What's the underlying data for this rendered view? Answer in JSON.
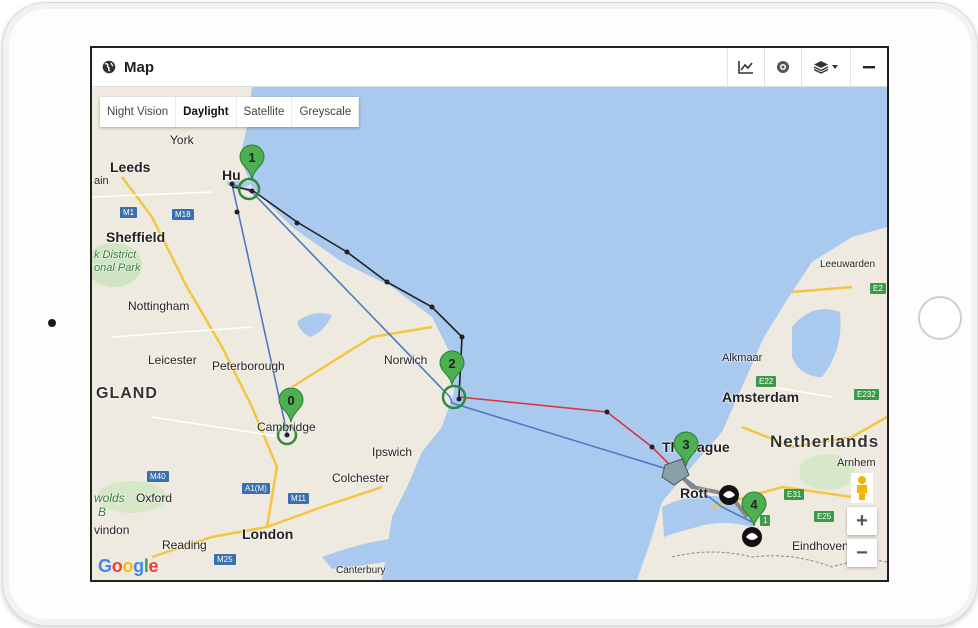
{
  "header": {
    "title": "Map",
    "tools": [
      "chart-icon",
      "target-icon",
      "layers-icon",
      "minimize-icon"
    ]
  },
  "map_types": {
    "items": [
      "Night Vision",
      "Daylight",
      "Satellite",
      "Greyscale"
    ],
    "active": "Daylight"
  },
  "zoom": {
    "in": "+",
    "out": "−"
  },
  "places": {
    "york": "York",
    "leeds": "Leeds",
    "sheffield": "Sheffield",
    "peak": "k District",
    "park": "onal Park",
    "nottingham": "Nottingham",
    "leicester": "Leicester",
    "peterborough": "Peterborough",
    "england": "GLAND",
    "norwich": "Norwich",
    "cambridge": "Cambridge",
    "ipswich": "Ipswich",
    "colchester": "Colchester",
    "oxford": "Oxford",
    "cotswolds": "wolds",
    "swindon": "vindon",
    "reading": "Reading",
    "london": "London",
    "canterbury": "Canterbury",
    "hull": "Hu",
    "alkmaar": "Alkmaar",
    "amsterdam": "Amsterdam",
    "the_hague": "Th  Hague",
    "netherlands": "Netherlands",
    "arnhem": "Arnhem",
    "rotterdam": "Rott",
    "eindhoven": "Eindhoven",
    "leeuwarden": "Leeuwarden",
    "ain": "ain",
    "b": "B"
  },
  "roads": {
    "m1": "M1",
    "m18": "M18",
    "m40": "M40",
    "a1m": "A1(M)",
    "m11": "M11",
    "m25": "M25",
    "e22": "E22",
    "e232": "E232",
    "e31": "E31",
    "e25": "E25",
    "e2": "E2",
    "e1": "1"
  },
  "waypoints": [
    {
      "label": "0"
    },
    {
      "label": "1"
    },
    {
      "label": "2"
    },
    {
      "label": "3"
    },
    {
      "label": "4"
    }
  ],
  "google": {
    "letters": [
      "G",
      "o",
      "o",
      "g",
      "l",
      "e"
    ],
    "colors": [
      "#4285f4",
      "#ea4335",
      "#fbbc05",
      "#4285f4",
      "#34a853",
      "#ea4335"
    ]
  },
  "colors": {
    "water": "#a9c9ef",
    "land": "#eeeadf",
    "marker": "#4caf50",
    "route_blue": "#4d79c9",
    "route_black": "#222222",
    "route_red": "#d9363e"
  }
}
